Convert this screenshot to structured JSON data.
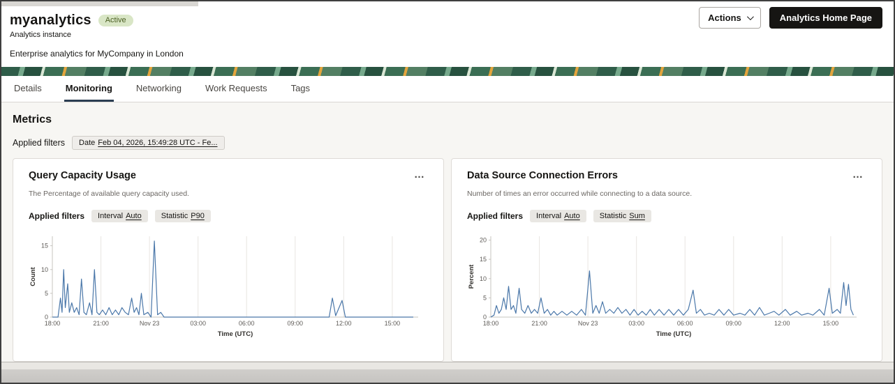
{
  "header": {
    "title": "myanalytics",
    "status_badge": "Active",
    "subtitle": "Analytics instance",
    "description": "Enterprise analytics for MyCompany in London",
    "actions_button": "Actions",
    "home_button": "Analytics Home Page"
  },
  "tabs": [
    {
      "label": "Details"
    },
    {
      "label": "Monitoring"
    },
    {
      "label": "Networking"
    },
    {
      "label": "Work Requests"
    },
    {
      "label": "Tags"
    }
  ],
  "metrics": {
    "heading": "Metrics",
    "applied_filters_label": "Applied filters",
    "date_filter": {
      "prefix": "Date",
      "value": "Feb 04, 2026, 15:49:28 UTC - Fe..."
    }
  },
  "cards": [
    {
      "title": "Query Capacity Usage",
      "description": "The Percentage of available query capacity used.",
      "applied_filters_label": "Applied filters",
      "filters": [
        {
          "label": "Interval",
          "value": "Auto"
        },
        {
          "label": "Statistic",
          "value": "P90"
        }
      ]
    },
    {
      "title": "Data Source Connection Errors",
      "description": "Number of times an error occurred while connecting to a data source.",
      "applied_filters_label": "Applied filters",
      "filters": [
        {
          "label": "Interval",
          "value": "Auto"
        },
        {
          "label": "Statistic",
          "value": "Sum"
        }
      ]
    }
  ],
  "chart_data": [
    {
      "type": "line",
      "title": "Query Capacity Usage",
      "xlabel": "Time (UTC)",
      "ylabel": "Count",
      "ylim": [
        0,
        17
      ],
      "yticks": [
        0,
        5,
        10,
        15
      ],
      "xlim": [
        0,
        22.6
      ],
      "xticks": [
        {
          "t": 0,
          "label": "18:00"
        },
        {
          "t": 3,
          "label": "21:00"
        },
        {
          "t": 6,
          "label": "Nov 23"
        },
        {
          "t": 9,
          "label": "03:00"
        },
        {
          "t": 12,
          "label": "06:00"
        },
        {
          "t": 15,
          "label": "09:00"
        },
        {
          "t": 18,
          "label": "12:00"
        },
        {
          "t": 21,
          "label": "15:00"
        }
      ],
      "line_color": "#4a77a9",
      "points": [
        [
          0,
          0
        ],
        [
          0.35,
          0
        ],
        [
          0.5,
          4
        ],
        [
          0.6,
          1
        ],
        [
          0.7,
          10
        ],
        [
          0.8,
          2
        ],
        [
          0.95,
          7
        ],
        [
          1.05,
          1
        ],
        [
          1.2,
          3
        ],
        [
          1.35,
          1
        ],
        [
          1.5,
          2
        ],
        [
          1.65,
          0.5
        ],
        [
          1.8,
          8
        ],
        [
          1.95,
          1
        ],
        [
          2.1,
          0.5
        ],
        [
          2.3,
          3
        ],
        [
          2.45,
          0.5
        ],
        [
          2.6,
          10
        ],
        [
          2.75,
          1
        ],
        [
          2.9,
          0.5
        ],
        [
          3.1,
          1.5
        ],
        [
          3.3,
          0.5
        ],
        [
          3.5,
          2
        ],
        [
          3.7,
          0.5
        ],
        [
          3.9,
          1.5
        ],
        [
          4.1,
          0.5
        ],
        [
          4.3,
          2
        ],
        [
          4.5,
          1
        ],
        [
          4.7,
          0.5
        ],
        [
          4.9,
          4
        ],
        [
          5.05,
          1
        ],
        [
          5.2,
          2
        ],
        [
          5.35,
          0.5
        ],
        [
          5.5,
          5
        ],
        [
          5.65,
          0.5
        ],
        [
          5.9,
          1
        ],
        [
          6.1,
          0
        ],
        [
          6.3,
          16
        ],
        [
          6.5,
          0.5
        ],
        [
          6.7,
          1
        ],
        [
          6.9,
          0
        ],
        [
          8,
          0
        ],
        [
          10,
          0
        ],
        [
          12,
          0
        ],
        [
          14,
          0
        ],
        [
          16,
          0
        ],
        [
          17.1,
          0
        ],
        [
          17.3,
          4
        ],
        [
          17.5,
          0.3
        ],
        [
          17.9,
          3.5
        ],
        [
          18.1,
          0
        ],
        [
          19,
          0
        ],
        [
          20,
          0
        ],
        [
          21,
          0
        ],
        [
          22.3,
          0
        ]
      ]
    },
    {
      "type": "line",
      "title": "Data Source Connection Errors",
      "xlabel": "Time (UTC)",
      "ylabel": "Percent",
      "ylim": [
        0,
        21
      ],
      "yticks": [
        0,
        5,
        10,
        15,
        20
      ],
      "xlim": [
        0,
        22.6
      ],
      "xticks": [
        {
          "t": 0,
          "label": "18:00"
        },
        {
          "t": 3,
          "label": "21:00"
        },
        {
          "t": 6,
          "label": "Nov 23"
        },
        {
          "t": 9,
          "label": "03:00"
        },
        {
          "t": 12,
          "label": "06:00"
        },
        {
          "t": 15,
          "label": "09:00"
        },
        {
          "t": 18,
          "label": "12:00"
        },
        {
          "t": 21,
          "label": "15:00"
        }
      ],
      "line_color": "#4a77a9",
      "points": [
        [
          0,
          0
        ],
        [
          0.2,
          0.5
        ],
        [
          0.35,
          3
        ],
        [
          0.5,
          1
        ],
        [
          0.65,
          2
        ],
        [
          0.8,
          5
        ],
        [
          0.95,
          2
        ],
        [
          1.1,
          8
        ],
        [
          1.25,
          2
        ],
        [
          1.4,
          3
        ],
        [
          1.55,
          1
        ],
        [
          1.75,
          7.5
        ],
        [
          1.9,
          2
        ],
        [
          2.1,
          1
        ],
        [
          2.3,
          3
        ],
        [
          2.5,
          1
        ],
        [
          2.7,
          2
        ],
        [
          2.9,
          1
        ],
        [
          3.1,
          5
        ],
        [
          3.3,
          1
        ],
        [
          3.5,
          2
        ],
        [
          3.7,
          0.5
        ],
        [
          3.9,
          1.5
        ],
        [
          4.1,
          0.5
        ],
        [
          4.4,
          1.5
        ],
        [
          4.7,
          0.5
        ],
        [
          5.0,
          1.5
        ],
        [
          5.3,
          0.5
        ],
        [
          5.6,
          2
        ],
        [
          5.85,
          0.5
        ],
        [
          6.1,
          12
        ],
        [
          6.3,
          1
        ],
        [
          6.5,
          3
        ],
        [
          6.7,
          1
        ],
        [
          6.9,
          4
        ],
        [
          7.1,
          1
        ],
        [
          7.35,
          2
        ],
        [
          7.6,
          1
        ],
        [
          7.85,
          2.5
        ],
        [
          8.1,
          1
        ],
        [
          8.35,
          2
        ],
        [
          8.6,
          0.5
        ],
        [
          8.85,
          2
        ],
        [
          9.1,
          0.5
        ],
        [
          9.35,
          1.5
        ],
        [
          9.6,
          0.5
        ],
        [
          9.85,
          2
        ],
        [
          10.1,
          0.5
        ],
        [
          10.4,
          2
        ],
        [
          10.7,
          0.5
        ],
        [
          11.0,
          2
        ],
        [
          11.3,
          0.5
        ],
        [
          11.6,
          2
        ],
        [
          11.9,
          0.5
        ],
        [
          12.2,
          2
        ],
        [
          12.5,
          7
        ],
        [
          12.7,
          1
        ],
        [
          12.95,
          2
        ],
        [
          13.2,
          0.5
        ],
        [
          13.5,
          1
        ],
        [
          13.8,
          0.5
        ],
        [
          14.1,
          2
        ],
        [
          14.4,
          0.5
        ],
        [
          14.7,
          2
        ],
        [
          15.0,
          0.5
        ],
        [
          15.4,
          1
        ],
        [
          15.7,
          0.5
        ],
        [
          16.0,
          2
        ],
        [
          16.3,
          0.5
        ],
        [
          16.6,
          2.5
        ],
        [
          16.9,
          0.5
        ],
        [
          17.2,
          1
        ],
        [
          17.5,
          1.5
        ],
        [
          17.8,
          0.5
        ],
        [
          18.2,
          2
        ],
        [
          18.5,
          0.5
        ],
        [
          18.9,
          1.5
        ],
        [
          19.2,
          0.5
        ],
        [
          19.6,
          1
        ],
        [
          19.9,
          0.5
        ],
        [
          20.3,
          2
        ],
        [
          20.6,
          0.5
        ],
        [
          20.9,
          7.5
        ],
        [
          21.1,
          1
        ],
        [
          21.4,
          2
        ],
        [
          21.6,
          1
        ],
        [
          21.8,
          9
        ],
        [
          21.95,
          3
        ],
        [
          22.1,
          8.5
        ],
        [
          22.25,
          2
        ],
        [
          22.4,
          0.5
        ]
      ]
    }
  ]
}
